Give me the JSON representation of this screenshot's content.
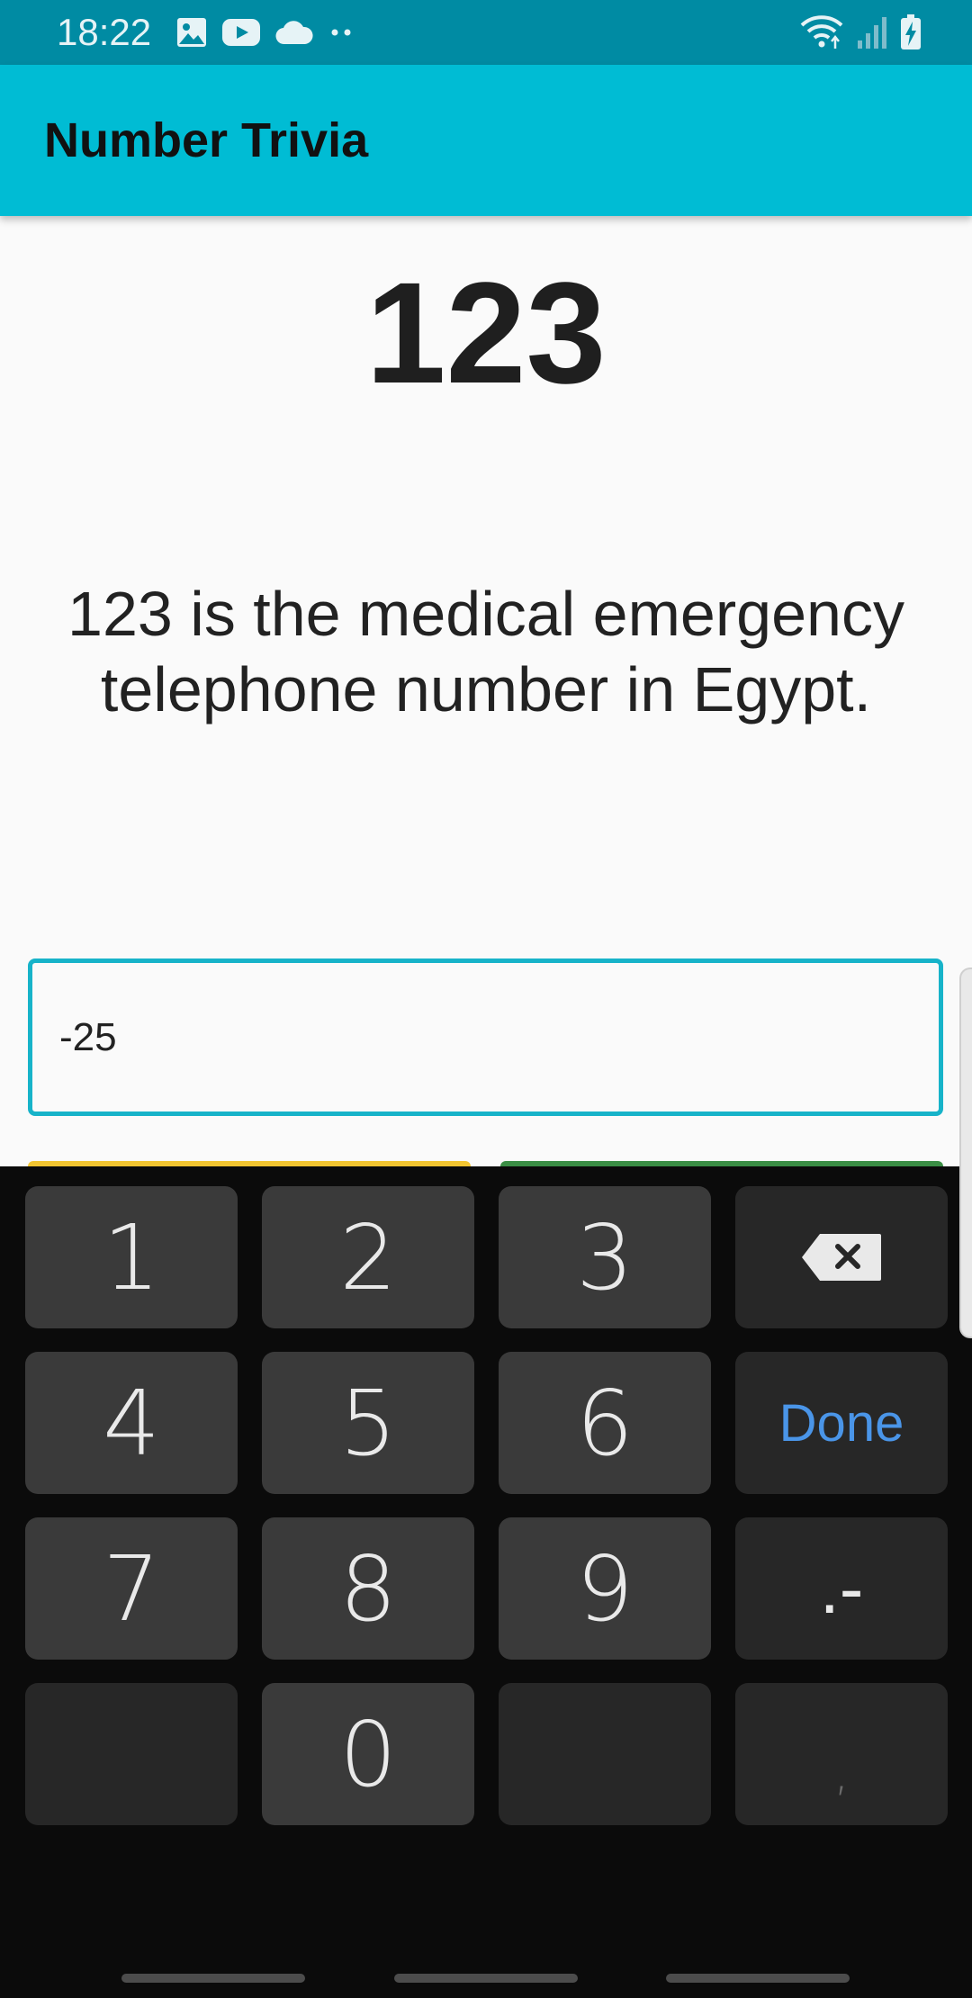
{
  "status_bar": {
    "time": "18:22",
    "icons_left": [
      "image-icon",
      "youtube-icon",
      "cloud-icon",
      "more-notifications-icon"
    ],
    "icons_right": [
      "wifi-icon",
      "signal-icon",
      "battery-charging-icon"
    ],
    "background": "#008ba3"
  },
  "app_bar": {
    "title": "Number Trivia",
    "background": "#00bcd4"
  },
  "trivia": {
    "number": "123",
    "text": "123 is the medical emergency telephone number in Egypt."
  },
  "input": {
    "value": "-25",
    "border_color": "#17b3c9"
  },
  "buttons": {
    "left_color": "#f2c531",
    "right_color": "#3b8e45"
  },
  "keyboard": {
    "keys": [
      "1",
      "2",
      "3",
      "4",
      "5",
      "6",
      "7",
      "8",
      "9",
      "0"
    ],
    "backspace_icon": "backspace-icon",
    "done_label": "Done",
    "dot_minus_label": ".-",
    "comma_label": ",",
    "done_color": "#4a95e8"
  }
}
